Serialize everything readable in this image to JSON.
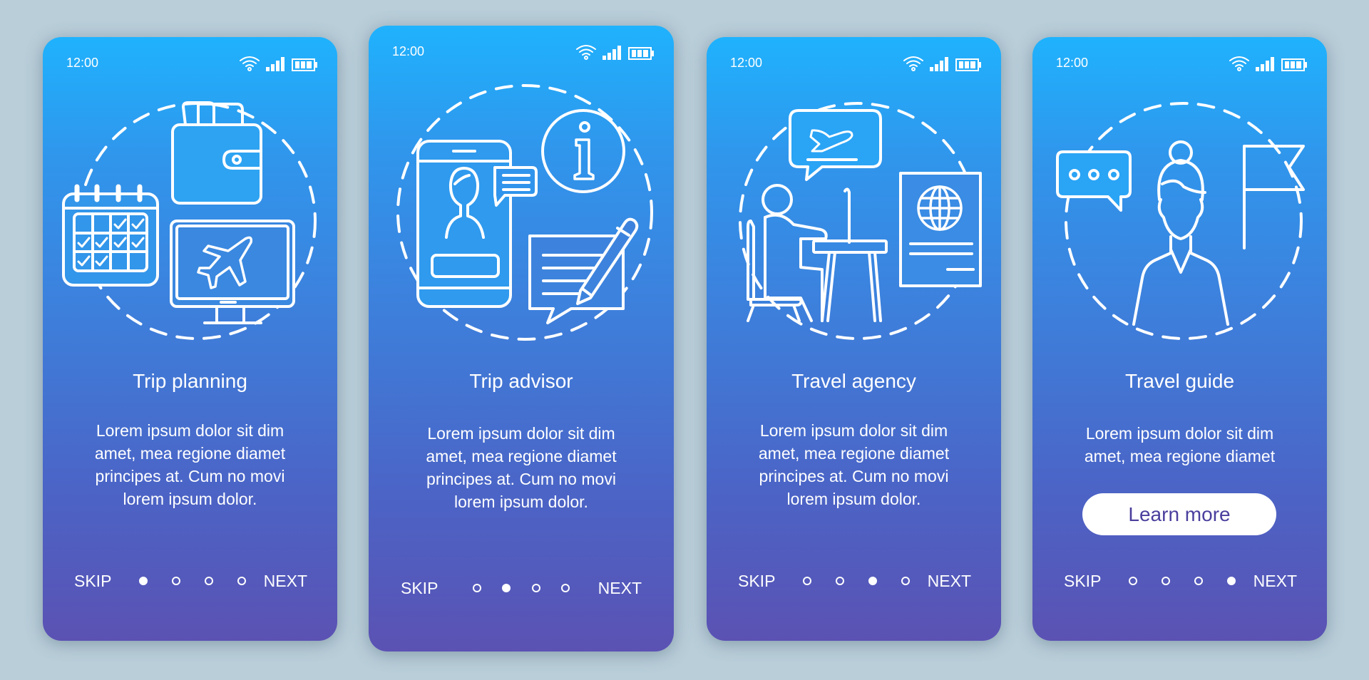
{
  "colors": {
    "background": "#b9ced9",
    "gradient_top": "#1fb2fd",
    "gradient_bottom": "#5b52b3",
    "button_text": "#4a3f9d"
  },
  "screens": [
    {
      "status": {
        "time": "12:00",
        "icons": [
          "wifi-icon",
          "signal-icon",
          "battery-icon"
        ]
      },
      "illustration": [
        "dashed-circle",
        "wallet-icon",
        "calendar-icon",
        "monitor-icon",
        "airplane-icon"
      ],
      "title": "Trip planning",
      "body": [
        "Lorem ipsum dolor sit dim",
        "amet, mea regione diamet",
        "principes at. Cum no movi",
        "lorem ipsum dolor."
      ],
      "nav": {
        "skip": "SKIP",
        "next": "NEXT",
        "page_count": 4,
        "active_page": 1
      }
    },
    {
      "status": {
        "time": "12:00",
        "icons": [
          "wifi-icon",
          "signal-icon",
          "battery-icon"
        ]
      },
      "illustration": [
        "dashed-circle",
        "smartphone-icon",
        "user-avatar-icon",
        "chat-bubble-icon",
        "info-icon",
        "note-icon",
        "pencil-icon"
      ],
      "title": "Trip advisor",
      "body": [
        "Lorem ipsum dolor sit dim",
        "amet, mea regione diamet",
        "principes at. Cum no movi",
        "lorem ipsum dolor."
      ],
      "nav": {
        "skip": "SKIP",
        "next": "NEXT",
        "page_count": 4,
        "active_page": 2
      }
    },
    {
      "status": {
        "time": "12:00",
        "icons": [
          "wifi-icon",
          "signal-icon",
          "battery-icon"
        ]
      },
      "illustration": [
        "dashed-circle",
        "person-at-desk-icon",
        "laptop-icon",
        "speech-bubble-airplane-icon",
        "passport-icon",
        "globe-icon"
      ],
      "title": "Travel agency",
      "body": [
        "Lorem ipsum dolor sit dim",
        "amet, mea regione diamet",
        "principes at. Cum no movi",
        "lorem ipsum dolor."
      ],
      "nav": {
        "skip": "SKIP",
        "next": "NEXT",
        "page_count": 4,
        "active_page": 3
      }
    },
    {
      "status": {
        "time": "12:00",
        "icons": [
          "wifi-icon",
          "signal-icon",
          "battery-icon"
        ]
      },
      "illustration": [
        "dashed-circle",
        "chat-dots-icon",
        "woman-guide-icon",
        "flag-icon"
      ],
      "title": "Travel guide",
      "body": [
        "Lorem ipsum dolor sit dim",
        "amet, mea regione diamet"
      ],
      "button": "Learn more",
      "nav": {
        "skip": "SKIP",
        "next": "NEXT",
        "page_count": 4,
        "active_page": 4
      }
    }
  ]
}
